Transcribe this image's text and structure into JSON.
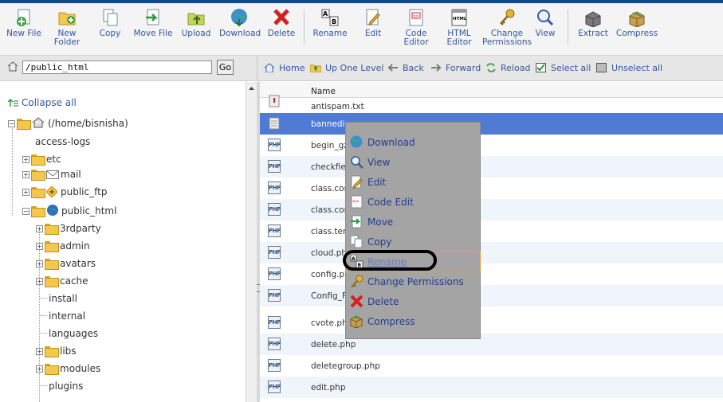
{
  "toolbar": {
    "buttons": [
      {
        "label1": "New File",
        "label2": "",
        "icon": "new-file-icon"
      },
      {
        "label1": "New",
        "label2": "Folder",
        "icon": "new-folder-icon"
      },
      {
        "label1": "Copy",
        "label2": "",
        "icon": "copy-icon"
      },
      {
        "label1": "Move File",
        "label2": "",
        "icon": "move-file-icon"
      },
      {
        "label1": "Upload",
        "label2": "",
        "icon": "upload-icon"
      },
      {
        "label1": "Download",
        "label2": "",
        "icon": "download-icon"
      },
      {
        "label1": "Delete",
        "label2": "",
        "icon": "delete-icon"
      },
      {
        "label1": "Rename",
        "label2": "",
        "icon": "rename-icon"
      },
      {
        "label1": "Edit",
        "label2": "",
        "icon": "edit-icon"
      },
      {
        "label1": "Code",
        "label2": "Editor",
        "icon": "code-editor-icon"
      },
      {
        "label1": "HTML",
        "label2": "Editor",
        "icon": "html-editor-icon"
      },
      {
        "label1": "Change",
        "label2": "Permissions",
        "icon": "key-icon"
      },
      {
        "label1": "View",
        "label2": "",
        "icon": "magnifier-icon"
      },
      {
        "label1": "Extract",
        "label2": "",
        "icon": "extract-icon"
      },
      {
        "label1": "Compress",
        "label2": "",
        "icon": "compress-icon"
      }
    ]
  },
  "nav": {
    "path_value": "/public_html",
    "go_label": "Go",
    "home": "Home",
    "up_one_level": "Up One Level",
    "back": "Back",
    "forward": "Forward",
    "reload": "Reload",
    "select_all": "Select all",
    "unselect_all": "Unselect all"
  },
  "tree": {
    "collapse_all": "Collapse all",
    "root": "(/home/bisnisha)",
    "access_logs": "access-logs",
    "etc": "etc",
    "mail": "mail",
    "public_ftp": "public_ftp",
    "public_html": "public_html",
    "children": [
      "3rdparty",
      "admin",
      "avatars",
      "cache",
      "install",
      "internal",
      "languages",
      "libs",
      "modules",
      "plugins"
    ]
  },
  "files": {
    "column_name": "Name",
    "rows": [
      {
        "name": "antispam.txt",
        "type": "txt"
      },
      {
        "name": "bannedip…",
        "type": "txt"
      },
      {
        "name": "begin_gz",
        "type": "php"
      },
      {
        "name": "checkfiel",
        "type": "php"
      },
      {
        "name": "class.cor",
        "type": "php"
      },
      {
        "name": "class.cor",
        "type": "php"
      },
      {
        "name": "class.tem",
        "type": "php"
      },
      {
        "name": "cloud.pha",
        "type": "php"
      },
      {
        "name": "config.ph",
        "type": "php"
      },
      {
        "name": "Config_Fi",
        "type": "php"
      },
      {
        "name": "cvote.php",
        "type": "php"
      },
      {
        "name": "delete.php",
        "type": "php"
      },
      {
        "name": "deletegroup.php",
        "type": "php"
      },
      {
        "name": "edit.php",
        "type": "php"
      }
    ]
  },
  "context_menu": {
    "items": [
      "Download",
      "View",
      "Edit",
      "Code Edit",
      "Move",
      "Copy",
      "Rename",
      "Change Permissions",
      "Delete",
      "Compress"
    ]
  }
}
